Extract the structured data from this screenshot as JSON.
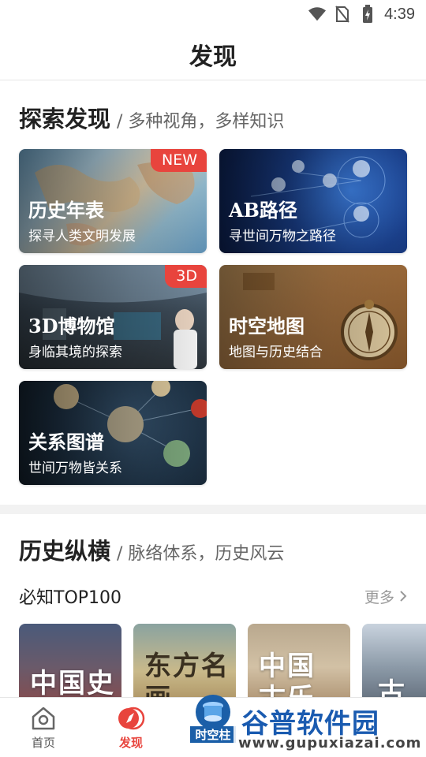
{
  "status": {
    "time": "4:39",
    "icons": [
      "wifi-icon",
      "no-sim-icon",
      "battery-charging-icon"
    ]
  },
  "header": {
    "title": "发现"
  },
  "explore": {
    "title": "探索发现",
    "subtitle": "/ 多种视角，多样知识",
    "cards": [
      {
        "title": "历史年表",
        "desc": "探寻人类文明发展",
        "badge": "NEW"
      },
      {
        "title": "AB路径",
        "desc": "寻世间万物之路径",
        "badge": ""
      },
      {
        "title": "3D博物馆",
        "desc": "身临其境的探索",
        "badge": "3D"
      },
      {
        "title": "时空地图",
        "desc": "地图与历史结合",
        "badge": ""
      },
      {
        "title": "关系图谱",
        "desc": "世间万物皆关系",
        "badge": ""
      }
    ]
  },
  "history": {
    "title": "历史纵横",
    "subtitle": "/ 脉络体系，历史风云",
    "top_label": "必知TOP100",
    "more_label": "更多",
    "books": [
      "中国史",
      "东方名画",
      "中国古乐",
      "古迹"
    ]
  },
  "tabbar": {
    "items": [
      {
        "label": "首页",
        "icon": "home-icon"
      },
      {
        "label": "发现",
        "icon": "compass-icon"
      },
      {
        "label": "时空柱",
        "icon": "pillar-icon"
      }
    ]
  },
  "watermark": {
    "title": "谷普软件园",
    "url": "www.gupuxiazai.com"
  }
}
